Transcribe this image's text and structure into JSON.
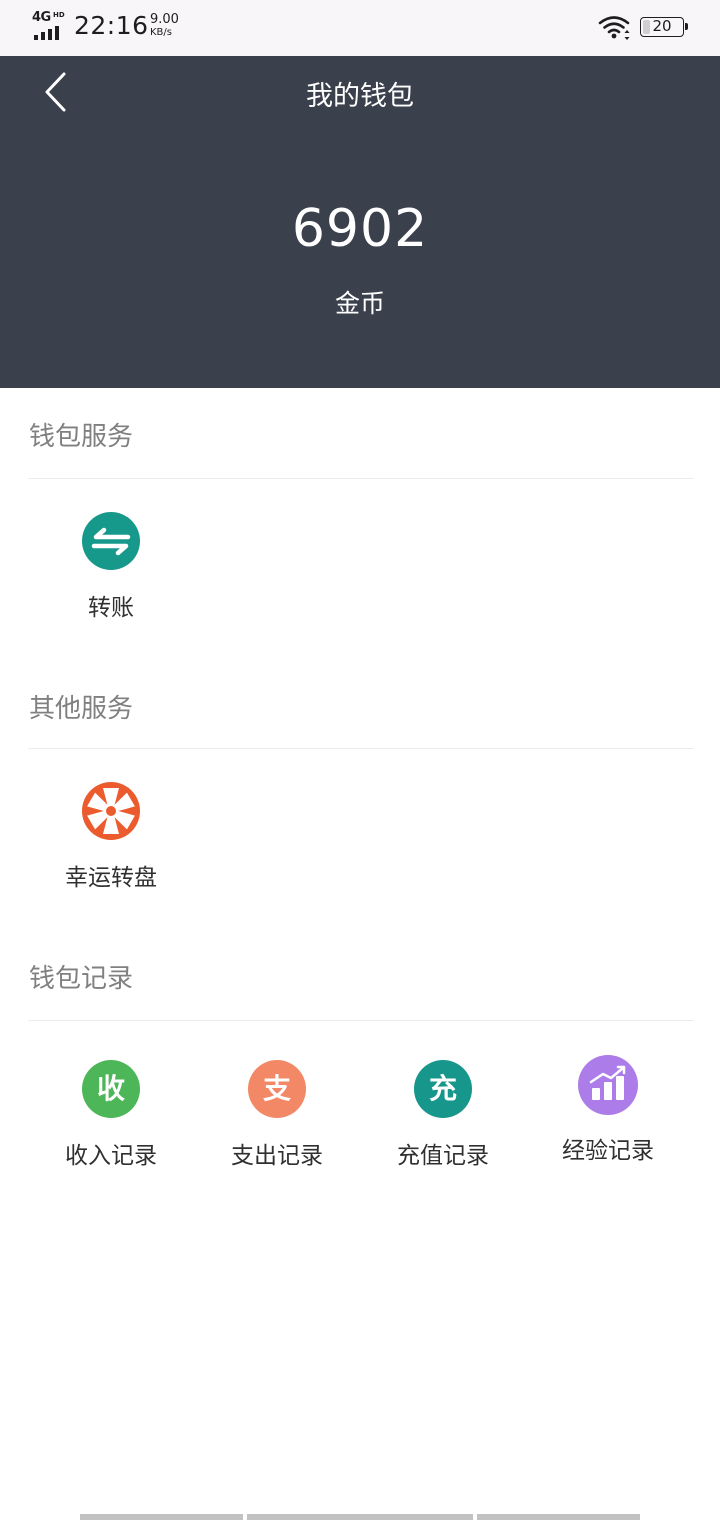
{
  "status_bar": {
    "network": "4G",
    "network_sup": "HD",
    "time": "22:16",
    "speed_value": "9.00",
    "speed_unit": "KB/s",
    "battery": "20",
    "battery_level": 0.2
  },
  "header": {
    "back_icon": "chevron-left-icon",
    "title": "我的钱包",
    "balance": "6902",
    "unit": "金币"
  },
  "sections": {
    "wallet_services": {
      "title": "钱包服务",
      "items": [
        {
          "label": "转账",
          "icon": "transfer-icon",
          "color": "#16988a"
        }
      ]
    },
    "other_services": {
      "title": "其他服务",
      "items": [
        {
          "label": "幸运转盘",
          "icon": "lucky-wheel-icon",
          "color": "#ec5b2d"
        }
      ]
    },
    "wallet_records": {
      "title": "钱包记录",
      "items": [
        {
          "label": "收入记录",
          "icon_text": "收",
          "icon": "income-icon",
          "color": "#4db658"
        },
        {
          "label": "支出记录",
          "icon_text": "支",
          "icon": "expense-icon",
          "color": "#f38866"
        },
        {
          "label": "充值记录",
          "icon_text": "充",
          "icon": "recharge-icon",
          "color": "#17968b"
        },
        {
          "label": "经验记录",
          "icon": "experience-chart-icon",
          "color": "#ac7ce8"
        }
      ]
    }
  },
  "colors": {
    "header_bg": "#3b404d",
    "section_title": "#808080",
    "label": "#303030"
  }
}
